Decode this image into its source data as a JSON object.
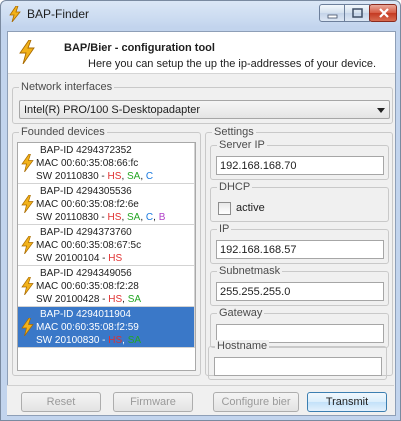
{
  "window": {
    "title": "BAP-Finder"
  },
  "header": {
    "title": "BAP/Bier - configuration tool",
    "subtitle": "Here you can setup the up the ip-addresses of your device."
  },
  "network": {
    "legend": "Network interfaces",
    "selected": "Intel(R) PRO/100 S-Desktopadapter"
  },
  "devices": {
    "legend": "Founded devices",
    "items": [
      {
        "id": "BAP-ID 4294372352",
        "mac": "MAC 00:60:35:08:66:fc",
        "sw": "SW 20110830 - ",
        "hs": "HS",
        "sa": "SA",
        "c": "C",
        "b": "",
        "selected": false
      },
      {
        "id": "BAP-ID 4294305536",
        "mac": "MAC 00:60:35:08:f2:6e",
        "sw": "SW 20110830 - ",
        "hs": "HS",
        "sa": "SA",
        "c": "C",
        "b": "B",
        "selected": false
      },
      {
        "id": "BAP-ID 4294373760",
        "mac": "MAC 00:60:35:08:67:5c",
        "sw": "SW 20100104 - ",
        "hs": "HS",
        "sa": "",
        "c": "",
        "b": "",
        "selected": false
      },
      {
        "id": "BAP-ID 4294349056",
        "mac": "MAC 00:60:35:08:f2:28",
        "sw": "SW 20100428 - ",
        "hs": "HS",
        "sa": "SA",
        "c": "",
        "b": "",
        "selected": false
      },
      {
        "id": "BAP-ID 4294011904",
        "mac": "MAC 00:60:35:08:f2:59",
        "sw": "SW 20100830 - ",
        "hs": "HS",
        "sa": "SA",
        "c": "",
        "b": "",
        "selected": true
      }
    ]
  },
  "settings": {
    "legend": "Settings",
    "server_ip": {
      "label": "Server IP",
      "value": "192.168.168.70"
    },
    "dhcp": {
      "label": "DHCP",
      "checkbox_label": "active",
      "checked": false
    },
    "ip": {
      "label": "IP",
      "value": "192.168.168.57"
    },
    "subnet": {
      "label": "Subnetmask",
      "value": "255.255.255.0"
    },
    "gateway": {
      "label": "Gateway",
      "value": ""
    },
    "hostname": {
      "label": "Hostname",
      "value": ""
    }
  },
  "buttons": {
    "reset": "Reset",
    "firmware": "Firmware",
    "configure": "Configure bier",
    "transmit": "Transmit"
  },
  "colors": {
    "hs": "#e03030",
    "sa": "#24a624",
    "c": "#1a7ae0",
    "b": "#b040c8",
    "selection": "#3a78c8",
    "icon": "#f2b21a"
  }
}
